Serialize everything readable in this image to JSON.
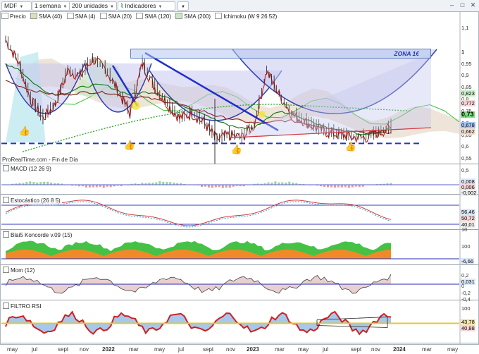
{
  "toolbar": {
    "symbol": "MDF",
    "timeframe": "1 semana",
    "units": "200 unidades",
    "indicators": "Indicadores"
  },
  "legend": [
    {
      "label": "Precio",
      "color": "#ffffff"
    },
    {
      "label": "SMA (40)",
      "color": "#d4e3b8"
    },
    {
      "label": "SMA (4)",
      "color": "#ffffff"
    },
    {
      "label": "SMA (20)",
      "color": "#ffffff"
    },
    {
      "label": "SMA (120)",
      "color": "#ffffff"
    },
    {
      "label": "SMA (200)",
      "color": "#c9e7c4"
    },
    {
      "label": "Ichimoku (W 9 26 52)",
      "color": "#ffffff"
    }
  ],
  "zone_label": "ZONA 1€",
  "credit": "ProRealTime.com - Fin de Día",
  "price_axis": [
    "1,1",
    "1",
    "0,95",
    "0,9",
    "0,85",
    "0,8",
    "0,75",
    "0,7",
    "0,65",
    "0,6",
    "0,55",
    "0,5"
  ],
  "price_tags": [
    {
      "text": "0,823",
      "color": "#c8f0c8"
    },
    {
      "text": "0,772",
      "color": "#f6d7d7"
    },
    {
      "text": "0,73",
      "color": "#7fe07f"
    },
    {
      "text": "0,678",
      "color": "#a9c5f0"
    },
    {
      "text": "0,662",
      "color": "#f3e0d0"
    }
  ],
  "panels": [
    {
      "label": "MACD (12 26 9)",
      "axis": [],
      "tags": [
        "0,008",
        "0,006",
        "-0,002"
      ]
    },
    {
      "label": "Estocástico (26 8 5)",
      "axis": [],
      "tags": [
        "56,46",
        "50,72",
        "40,01",
        "10"
      ]
    },
    {
      "label": "Blai5 Koncorde v.09 (15)",
      "axis": [
        "100",
        "0"
      ],
      "tags": [
        "-6,66"
      ]
    },
    {
      "label": "Mom (12)",
      "axis": [
        "0,2",
        "0",
        "-0,2",
        "-0,4"
      ],
      "tags": [
        "0,031"
      ]
    },
    {
      "label": "FILTRO RSI",
      "axis": [
        "100"
      ],
      "tags": [
        "43,78",
        "40,88"
      ]
    }
  ],
  "x_labels": [
    {
      "text": "may",
      "bold": false
    },
    {
      "text": "jul",
      "bold": false
    },
    {
      "text": "sept",
      "bold": false
    },
    {
      "text": "nov",
      "bold": false
    },
    {
      "text": "2022",
      "bold": true
    },
    {
      "text": "mar",
      "bold": false
    },
    {
      "text": "may",
      "bold": false
    },
    {
      "text": "jul",
      "bold": false
    },
    {
      "text": "sept",
      "bold": false
    },
    {
      "text": "nov",
      "bold": false
    },
    {
      "text": "2023",
      "bold": true
    },
    {
      "text": "mar",
      "bold": false
    },
    {
      "text": "may",
      "bold": false
    },
    {
      "text": "jul",
      "bold": false
    },
    {
      "text": "sept",
      "bold": false
    },
    {
      "text": "nov",
      "bold": false
    },
    {
      "text": "2024",
      "bold": true
    },
    {
      "text": "mar",
      "bold": false
    },
    {
      "text": "may",
      "bold": false
    }
  ],
  "chart_data": {
    "type": "line",
    "price_range": [
      0.53,
      1.13
    ],
    "x": [
      "2021-05",
      "2021-06",
      "2021-07",
      "2021-08",
      "2021-09",
      "2021-10",
      "2021-11",
      "2021-12",
      "2022-01",
      "2022-02",
      "2022-03",
      "2022-04",
      "2022-05",
      "2022-06",
      "2022-07",
      "2022-08",
      "2022-09",
      "2022-10",
      "2022-11",
      "2022-12",
      "2023-01",
      "2023-02",
      "2023-03",
      "2023-04",
      "2023-05",
      "2023-06",
      "2023-07",
      "2023-08",
      "2023-09",
      "2023-10",
      "2023-11",
      "2023-12"
    ],
    "series": [
      {
        "values": [
          1.05,
          0.96,
          0.8,
          0.72,
          0.78,
          0.92,
          0.9,
          0.97,
          0.93,
          0.84,
          0.74,
          0.95,
          0.85,
          0.78,
          0.72,
          0.74,
          0.7,
          0.63,
          0.65,
          0.64,
          0.69,
          0.92,
          0.82,
          0.74,
          0.71,
          0.68,
          0.66,
          0.65,
          0.64,
          0.64,
          0.66,
          0.68
        ]
      },
      {
        "values": [
          0.95,
          0.93,
          0.88,
          0.84,
          0.82,
          0.83,
          0.85,
          0.86,
          0.86,
          0.84,
          0.82,
          0.83,
          0.83,
          0.81,
          0.78,
          0.76,
          0.74,
          0.71,
          0.69,
          0.68,
          0.68,
          0.72,
          0.75,
          0.74,
          0.72,
          0.7,
          0.68,
          0.67,
          0.66,
          0.65,
          0.66,
          0.68
        ]
      },
      {
        "values": [
          0.88,
          0.86,
          0.84,
          0.83,
          0.82,
          0.82,
          0.83,
          0.83,
          0.83,
          0.82,
          0.81,
          0.81,
          0.8,
          0.79,
          0.78,
          0.76,
          0.75,
          0.73,
          0.72,
          0.71,
          0.7,
          0.7,
          0.71,
          0.71,
          0.7,
          0.69,
          0.68,
          0.67,
          0.67,
          0.66,
          0.66,
          0.66
        ]
      }
    ],
    "support": 0.615,
    "resistance_zone": [
      0.96,
      0.99
    ]
  }
}
